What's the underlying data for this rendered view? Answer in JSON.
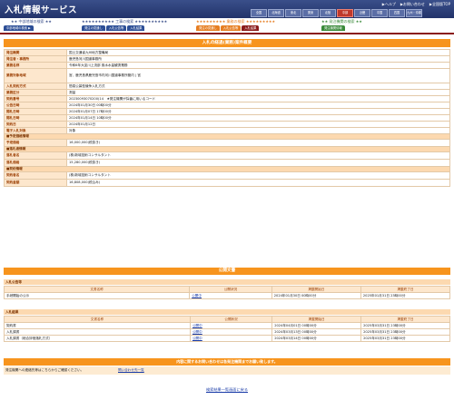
{
  "header": {
    "title": "入札情報サービス",
    "links": [
      "▶ヘルプ",
      "▶お問い合わせ",
      "▶全国版TOP"
    ],
    "regions": [
      {
        "label": "全国",
        "selected": false
      },
      {
        "label": "北海道",
        "selected": false
      },
      {
        "label": "東北",
        "selected": false
      },
      {
        "label": "関東",
        "selected": false
      },
      {
        "label": "北陸",
        "selected": false
      },
      {
        "label": "中部",
        "selected": true
      },
      {
        "label": "近畿",
        "selected": false
      },
      {
        "label": "中国",
        "selected": false
      },
      {
        "label": "四国",
        "selected": false
      },
      {
        "label": "九州・沖縄",
        "selected": false
      }
    ]
  },
  "categories": [
    {
      "title": "★★ 中部地域の検索 ★★",
      "color": "#3a4f8a",
      "tabs": [
        "中部地域の検索 ▶"
      ]
    },
    {
      "title": "★★★★★★★★★★ 工事の検索 ★★★★★★★★★★",
      "color": "#3a4f8a",
      "tabs": [
        "発注の見通し",
        "入札公告等",
        "入札結果"
      ]
    },
    {
      "title": "★★★★★★★★★ 業務の検索 ★★★★★★★★★",
      "color": "#e67e22",
      "tabs": [
        "発注の見通し",
        "入札公告等",
        "入札結果"
      ]
    },
    {
      "title": "★★ 発注機関の検索 ★★",
      "color": "#3a8a3a",
      "tabs": [
        "発注機関情報"
      ]
    }
  ],
  "colors": {
    "accent": "#f7941d",
    "header": "#2a3c78",
    "label_bg": "#fde7cd",
    "label_text": "#9a3d00",
    "link": "#1a3ca8",
    "selected_region": "#c0392b",
    "works_tab": "#2c4e96",
    "services_tab": "#e67e22",
    "services_selected_tab": "#8a1a1a",
    "agency_tab": "#3a8a3a"
  },
  "detail": {
    "title": "入札の経過(業務)案件概要",
    "rows": [
      {
        "label": "発注機関",
        "value": "国土交通省九州地方整備局"
      },
      {
        "label": "発注者・事務所",
        "value": "鹿児島河川国道事務所"
      },
      {
        "label": "業務名称",
        "value": "令和6年大淀川上流部 風水水量観測業務"
      },
      {
        "label": "業務対象地域",
        "value": "宮、鹿児島県鹿児島市内河川国道事務所管内 | 宮"
      },
      {
        "label": "入札契約方式",
        "value": "簡易公募型競争入札方式"
      },
      {
        "label": "業務区分",
        "value": "測量"
      },
      {
        "label": "契約番号",
        "value": "20230093070200(14　★発注機関が採番に用いるコード"
      },
      {
        "label": "公告日時",
        "value": "2024年01月30日 00時00分"
      },
      {
        "label": "開札日時",
        "value": "2024年01月07日 17時00分"
      },
      {
        "label": "開札日時",
        "value": "2024年01月14日 10時00分"
      },
      {
        "label": "契約日",
        "value": "2024年01月12日"
      },
      {
        "label": "電子入札対象",
        "value": "対象"
      },
      {
        "section": "■予定価格情報"
      },
      {
        "label": "予定価格",
        "value": "16,000,000(税抜き)"
      },
      {
        "section": "■落札者情報"
      },
      {
        "label": "落札者名",
        "value": "(株)新城技術コンサルタント"
      },
      {
        "label": "落札価格",
        "value": "15,280,000(税抜き)"
      },
      {
        "section": "■契約情報"
      },
      {
        "label": "契約者名",
        "value": "(株)新城技術コンサルタント"
      },
      {
        "label": "契約金額",
        "value": "16,808,000(税込み)"
      }
    ]
  },
  "documents": {
    "title": "公開文書",
    "columns": [
      "文書名称",
      "公開状況",
      "掲載開始日",
      "掲載終了日"
    ],
    "groups": [
      {
        "caption": "入札公告等",
        "rows": [
          {
            "name": "手続開始の公示",
            "status": "公開中",
            "start": "2024年01月30日 00時00分",
            "end": "2025年01月31日 23時00分"
          }
        ]
      },
      {
        "caption": "入札結果",
        "rows": [
          {
            "name": "契約書",
            "status": "公開中",
            "start": "2024年04月01日 00時00分",
            "end": "2025年03月31日 23時00分"
          },
          {
            "name": "入札調書",
            "status": "公開中",
            "start": "2024年03月13日 00時00分",
            "end": "2025年03月31日 23時00分"
          },
          {
            "name": "入札調書（総合評価落札方式）",
            "status": "公開中",
            "start": "2024年03月14日 00時00分",
            "end": "2025年03月31日 23時00分"
          }
        ]
      }
    ]
  },
  "contact": {
    "bar_text": "内容に関するお問い合わせは各発注機関までお願い致します。",
    "row_text": "発注機関への連絡先等はこちらからご確認ください。",
    "link": "問い合わせ先一覧"
  },
  "back_link": "検索結果一覧画面に戻る"
}
